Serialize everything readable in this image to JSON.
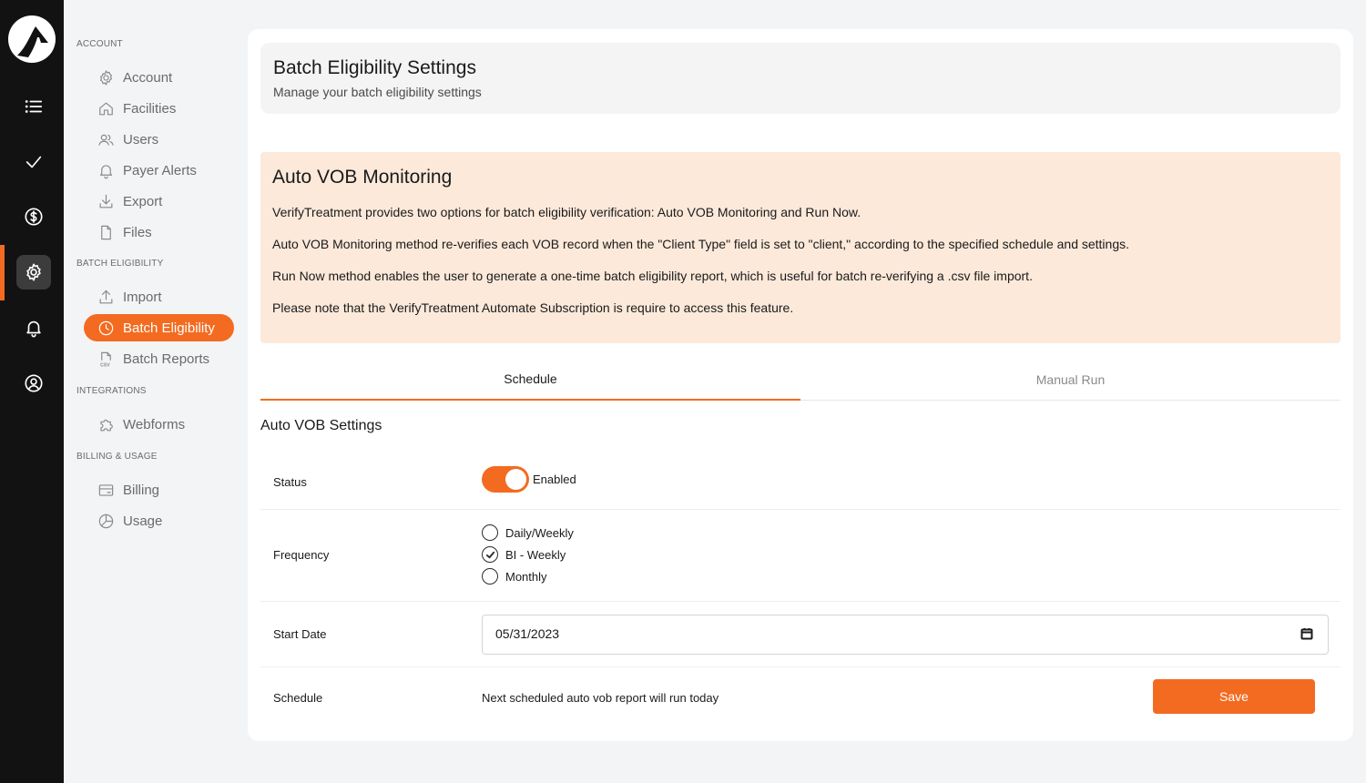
{
  "sidebar": {
    "sections": {
      "account": "ACCOUNT",
      "batch_eligibility": "BATCH ELIGIBILITY",
      "integrations": "INTEGRATIONS",
      "billing_usage": "BILLING & USAGE"
    },
    "items": {
      "account": "Account",
      "facilities": "Facilities",
      "users": "Users",
      "payer_alerts": "Payer Alerts",
      "export": "Export",
      "files": "Files",
      "import": "Import",
      "batch_eligibility": "Batch Eligibility",
      "batch_reports": "Batch Reports",
      "webforms": "Webforms",
      "billing": "Billing",
      "usage": "Usage"
    }
  },
  "header": {
    "title": "Batch Eligibility Settings",
    "subtitle": "Manage your batch eligibility settings"
  },
  "info": {
    "title": "Auto VOB Monitoring",
    "paragraphs": [
      "VerifyTreatment provides two options for batch eligibility verification: Auto VOB Monitoring and Run Now.",
      "Auto VOB Monitoring method re-verifies each VOB record when the \"Client Type\" field is set to \"client,\" according to the specified schedule and settings.",
      "Run Now method enables the user to generate a one-time batch eligibility report, which is useful for batch re-verifying a .csv file import.",
      "Please note that the VerifyTreatment Automate Subscription is require to access this feature."
    ]
  },
  "tabs": [
    "Schedule",
    "Manual Run"
  ],
  "settings": {
    "title": "Auto VOB Settings",
    "status_label": "Status",
    "status_value": "Enabled",
    "frequency_label": "Frequency",
    "frequency_options": [
      "Daily/Weekly",
      "BI - Weekly",
      "Monthly"
    ],
    "frequency_selected": "BI - Weekly",
    "start_date_label": "Start Date",
    "start_date_value": "05/31/2023",
    "schedule_label": "Schedule",
    "schedule_text": "Next scheduled auto vob report will run today",
    "save_label": "Save"
  },
  "colors": {
    "accent": "#f36b21",
    "rail": "#121212",
    "info_bg": "#fce9da"
  }
}
